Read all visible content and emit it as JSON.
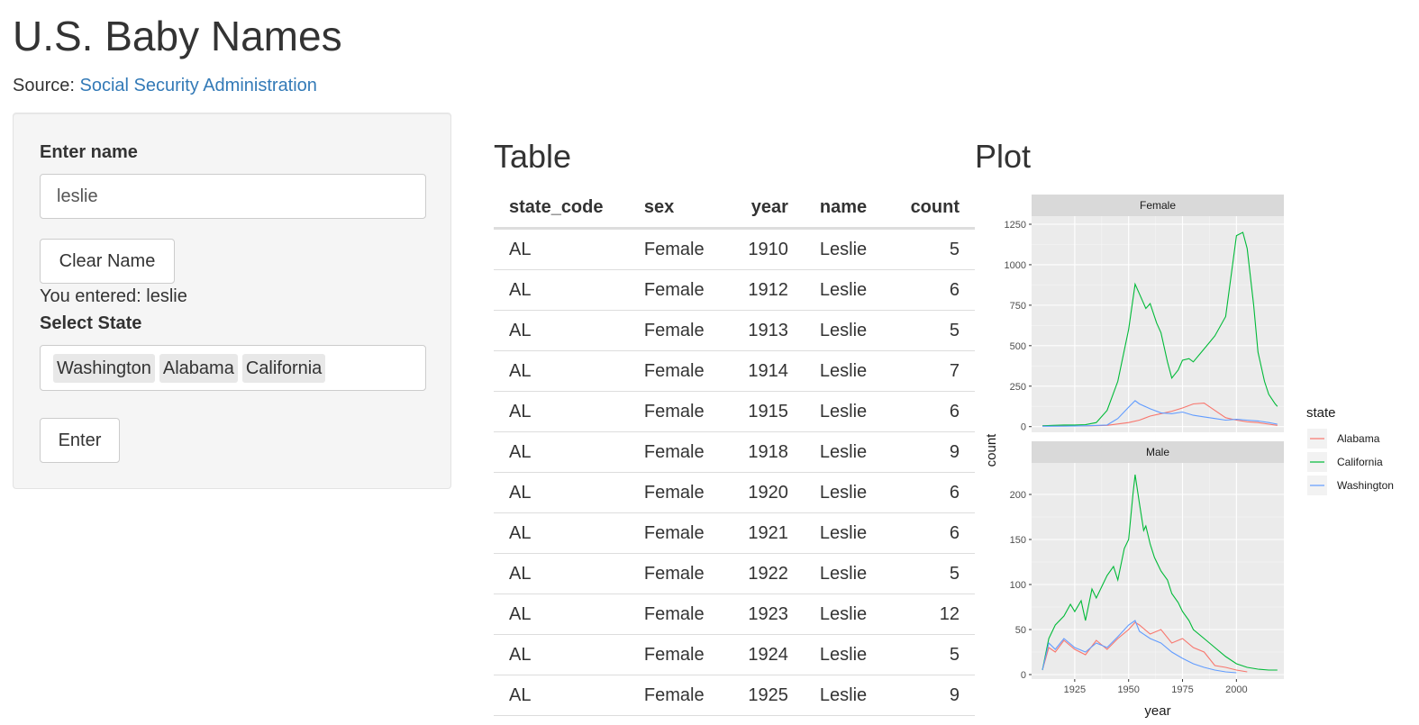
{
  "header": {
    "title": "U.S. Baby Names",
    "source_prefix": "Source: ",
    "source_link": "Social Security Administration"
  },
  "sidebar": {
    "name_label": "Enter name",
    "name_value": "leslie",
    "clear_button": "Clear Name",
    "echo": "You entered: leslie",
    "state_label": "Select State",
    "states": [
      "Washington",
      "Alabama",
      "California"
    ],
    "enter_button": "Enter"
  },
  "table": {
    "title": "Table",
    "columns": [
      "state_code",
      "sex",
      "year",
      "name",
      "count"
    ],
    "rows": [
      [
        "AL",
        "Female",
        "1910",
        "Leslie",
        "5"
      ],
      [
        "AL",
        "Female",
        "1912",
        "Leslie",
        "6"
      ],
      [
        "AL",
        "Female",
        "1913",
        "Leslie",
        "5"
      ],
      [
        "AL",
        "Female",
        "1914",
        "Leslie",
        "7"
      ],
      [
        "AL",
        "Female",
        "1915",
        "Leslie",
        "6"
      ],
      [
        "AL",
        "Female",
        "1918",
        "Leslie",
        "9"
      ],
      [
        "AL",
        "Female",
        "1920",
        "Leslie",
        "6"
      ],
      [
        "AL",
        "Female",
        "1921",
        "Leslie",
        "6"
      ],
      [
        "AL",
        "Female",
        "1922",
        "Leslie",
        "5"
      ],
      [
        "AL",
        "Female",
        "1923",
        "Leslie",
        "12"
      ],
      [
        "AL",
        "Female",
        "1924",
        "Leslie",
        "5"
      ],
      [
        "AL",
        "Female",
        "1925",
        "Leslie",
        "9"
      ]
    ]
  },
  "plot": {
    "title": "Plot"
  },
  "chart_data": {
    "type": "line",
    "xlabel": "year",
    "ylabel": "count",
    "xlim": [
      1905,
      2022
    ],
    "x_ticks": [
      1925,
      1950,
      1975,
      2000
    ],
    "legend": {
      "title": "state",
      "position": "right"
    },
    "grid": true,
    "series_colors": {
      "Alabama": "#F8766D",
      "California": "#00BA38",
      "Washington": "#619CFF"
    },
    "panels": [
      {
        "facet": "Female",
        "ylim": [
          -35,
          1300
        ],
        "y_ticks": [
          0,
          250,
          500,
          750,
          1000,
          1250
        ],
        "series": [
          {
            "name": "Alabama",
            "x": [
              1910,
              1920,
              1930,
              1940,
              1950,
              1955,
              1960,
              1965,
              1970,
              1975,
              1980,
              1985,
              1990,
              1995,
              2000,
              2005,
              2010,
              2015,
              2019
            ],
            "values": [
              5,
              6,
              4,
              8,
              25,
              40,
              65,
              80,
              95,
              115,
              140,
              145,
              100,
              55,
              40,
              30,
              25,
              15,
              8
            ]
          },
          {
            "name": "California",
            "x": [
              1910,
              1915,
              1920,
              1925,
              1930,
              1935,
              1940,
              1945,
              1950,
              1953,
              1955,
              1958,
              1960,
              1963,
              1965,
              1968,
              1970,
              1973,
              1975,
              1978,
              1980,
              1985,
              1990,
              1995,
              2000,
              2003,
              2005,
              2008,
              2010,
              2013,
              2015,
              2018,
              2019
            ],
            "values": [
              5,
              8,
              10,
              10,
              12,
              25,
              100,
              280,
              600,
              880,
              820,
              730,
              760,
              640,
              580,
              400,
              300,
              350,
              410,
              420,
              400,
              480,
              560,
              680,
              1180,
              1200,
              1100,
              750,
              460,
              280,
              200,
              140,
              125
            ]
          },
          {
            "name": "Washington",
            "x": [
              1910,
              1920,
              1930,
              1940,
              1945,
              1950,
              1953,
              1955,
              1960,
              1965,
              1970,
              1975,
              1980,
              1985,
              1990,
              1995,
              2000,
              2005,
              2010,
              2015,
              2019
            ],
            "values": [
              2,
              3,
              5,
              10,
              50,
              120,
              160,
              140,
              110,
              85,
              80,
              90,
              70,
              60,
              50,
              40,
              45,
              40,
              35,
              25,
              15
            ]
          }
        ]
      },
      {
        "facet": "Male",
        "ylim": [
          -5,
          235
        ],
        "y_ticks": [
          0,
          50,
          100,
          150,
          200
        ],
        "series": [
          {
            "name": "Alabama",
            "x": [
              1910,
              1913,
              1916,
              1920,
              1925,
              1930,
              1935,
              1940,
              1945,
              1950,
              1953,
              1955,
              1960,
              1965,
              1970,
              1975,
              1980,
              1985,
              1990,
              1995,
              2000,
              2005
            ],
            "values": [
              5,
              30,
              25,
              38,
              28,
              22,
              38,
              28,
              40,
              50,
              58,
              55,
              45,
              50,
              35,
              40,
              30,
              25,
              10,
              8,
              5,
              3
            ]
          },
          {
            "name": "California",
            "x": [
              1910,
              1913,
              1916,
              1920,
              1923,
              1925,
              1928,
              1930,
              1933,
              1935,
              1938,
              1940,
              1943,
              1945,
              1948,
              1950,
              1952,
              1953,
              1955,
              1957,
              1958,
              1960,
              1962,
              1965,
              1968,
              1970,
              1973,
              1975,
              1978,
              1980,
              1985,
              1990,
              1995,
              2000,
              2005,
              2010,
              2015,
              2019
            ],
            "values": [
              5,
              40,
              55,
              65,
              78,
              70,
              82,
              60,
              95,
              85,
              100,
              110,
              120,
              105,
              140,
              150,
              200,
              222,
              190,
              160,
              165,
              145,
              130,
              115,
              105,
              90,
              80,
              70,
              60,
              50,
              40,
              30,
              20,
              12,
              8,
              6,
              5,
              5
            ]
          },
          {
            "name": "Washington",
            "x": [
              1910,
              1913,
              1916,
              1920,
              1925,
              1930,
              1935,
              1940,
              1945,
              1950,
              1953,
              1955,
              1960,
              1965,
              1970,
              1975,
              1980,
              1985,
              1990,
              1995,
              2000
            ],
            "values": [
              5,
              35,
              28,
              40,
              30,
              25,
              35,
              30,
              42,
              55,
              60,
              48,
              40,
              35,
              25,
              18,
              12,
              8,
              5,
              3,
              2
            ]
          }
        ]
      }
    ]
  }
}
